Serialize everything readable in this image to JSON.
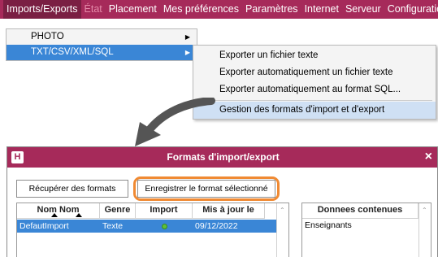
{
  "menubar": {
    "items": [
      {
        "label": "Imports/Exports"
      },
      {
        "label": "État"
      },
      {
        "label": "Placement"
      },
      {
        "label": "Mes préférences"
      },
      {
        "label": "Paramètres"
      },
      {
        "label": "Internet"
      },
      {
        "label": "Serveur"
      },
      {
        "label": "Configuration"
      }
    ]
  },
  "dropdown": {
    "items": [
      {
        "label": "PHOTO"
      },
      {
        "label": "TXT/CSV/XML/SQL"
      }
    ]
  },
  "submenu": {
    "items": [
      {
        "label": "Exporter un fichier texte"
      },
      {
        "label": "Exporter automatiquement un fichier texte"
      },
      {
        "label": "Exporter automatiquement au format SQL..."
      },
      {
        "label": "Gestion des formats d'import et d'export"
      }
    ]
  },
  "dialog": {
    "logo": "H",
    "title": "Formats d'import/export",
    "close": "×",
    "buttons": {
      "recuperer": "Récupérer des formats",
      "enregistrer": "Enregistrer le format sélectionné"
    },
    "table": {
      "headers": [
        "Nom",
        "Nom",
        "Genre",
        "Import",
        "Mis à jour le"
      ],
      "rows": [
        {
          "nom": "DefautImport",
          "genre": "Texte",
          "import": "green-dot",
          "date": "09/12/2022"
        }
      ]
    },
    "right_table": {
      "header": "Donnees contenues",
      "rows": [
        "Enseignants"
      ]
    }
  },
  "colors": {
    "accent": "#a62a5a",
    "selection": "#3a86d6",
    "highlight_ring": "#f08a33"
  }
}
